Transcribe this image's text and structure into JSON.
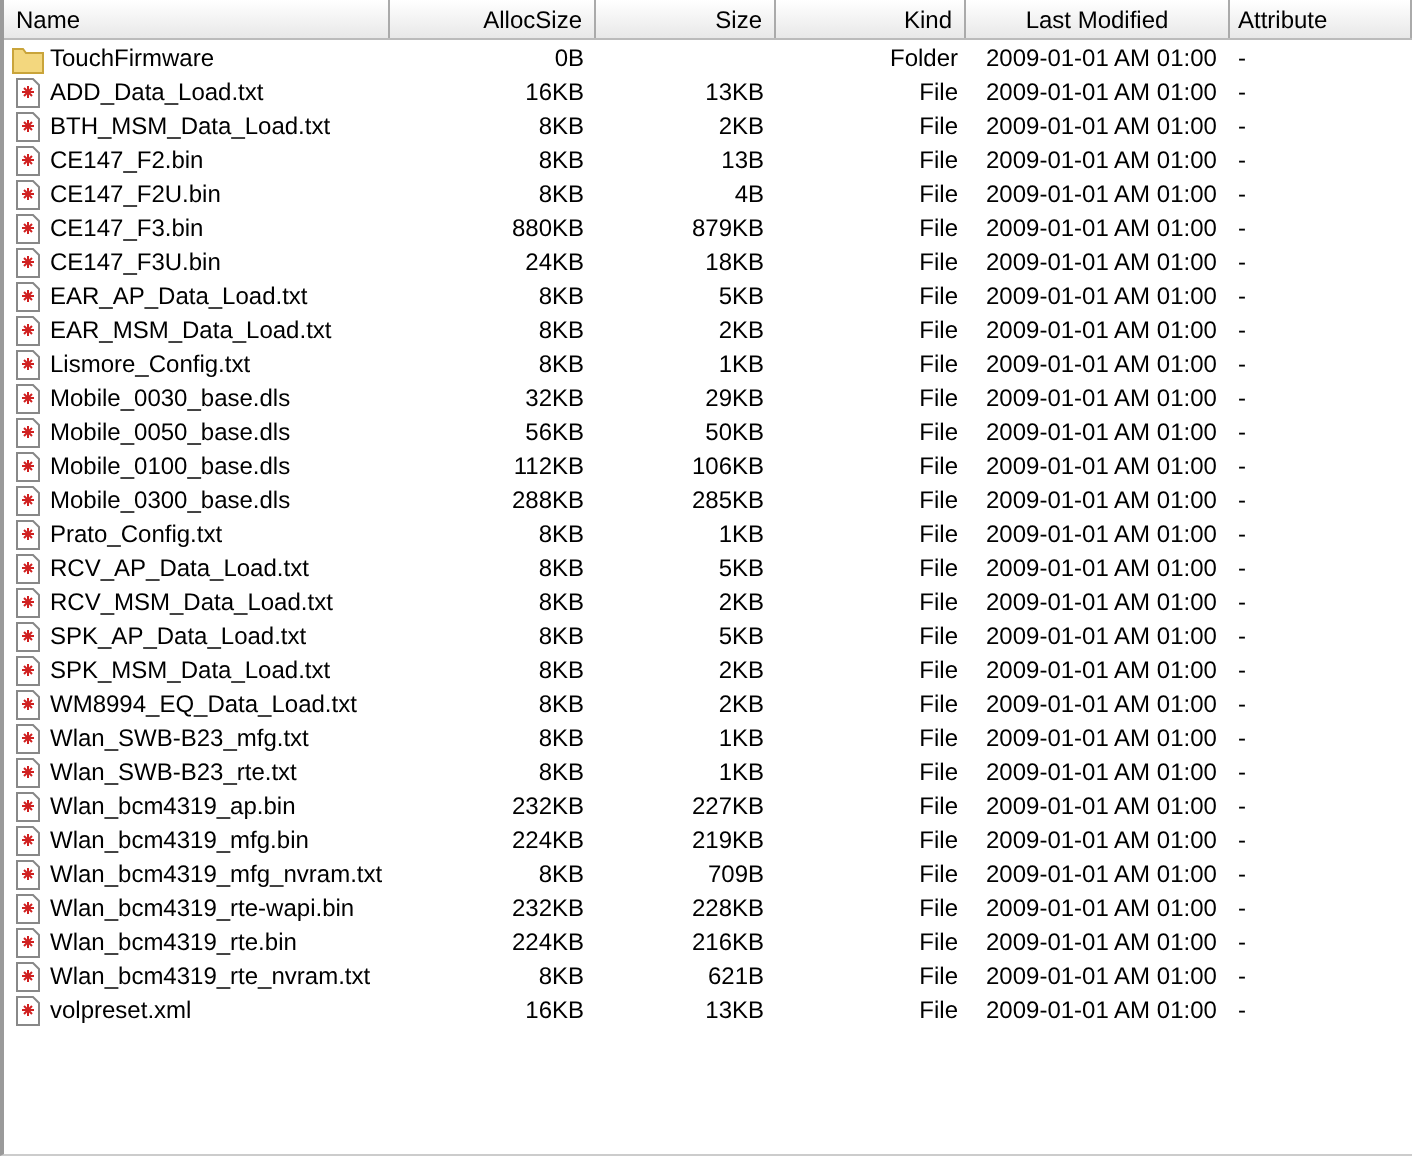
{
  "columns": [
    "Name",
    "AllocSize",
    "Size",
    "Kind",
    "Last Modified",
    "Attribute"
  ],
  "rows": [
    {
      "kind": "folder",
      "name": "TouchFirmware",
      "alloc": "0B",
      "size": "",
      "type": "Folder",
      "modified": "2009-01-01 AM 01:00",
      "attribute": "-"
    },
    {
      "kind": "file",
      "name": "ADD_Data_Load.txt",
      "alloc": "16KB",
      "size": "13KB",
      "type": "File",
      "modified": "2009-01-01 AM 01:00",
      "attribute": "-"
    },
    {
      "kind": "file",
      "name": "BTH_MSM_Data_Load.txt",
      "alloc": "8KB",
      "size": "2KB",
      "type": "File",
      "modified": "2009-01-01 AM 01:00",
      "attribute": "-"
    },
    {
      "kind": "file",
      "name": "CE147_F2.bin",
      "alloc": "8KB",
      "size": "13B",
      "type": "File",
      "modified": "2009-01-01 AM 01:00",
      "attribute": "-"
    },
    {
      "kind": "file",
      "name": "CE147_F2U.bin",
      "alloc": "8KB",
      "size": "4B",
      "type": "File",
      "modified": "2009-01-01 AM 01:00",
      "attribute": "-"
    },
    {
      "kind": "file",
      "name": "CE147_F3.bin",
      "alloc": "880KB",
      "size": "879KB",
      "type": "File",
      "modified": "2009-01-01 AM 01:00",
      "attribute": "-"
    },
    {
      "kind": "file",
      "name": "CE147_F3U.bin",
      "alloc": "24KB",
      "size": "18KB",
      "type": "File",
      "modified": "2009-01-01 AM 01:00",
      "attribute": "-"
    },
    {
      "kind": "file",
      "name": "EAR_AP_Data_Load.txt",
      "alloc": "8KB",
      "size": "5KB",
      "type": "File",
      "modified": "2009-01-01 AM 01:00",
      "attribute": "-"
    },
    {
      "kind": "file",
      "name": "EAR_MSM_Data_Load.txt",
      "alloc": "8KB",
      "size": "2KB",
      "type": "File",
      "modified": "2009-01-01 AM 01:00",
      "attribute": "-"
    },
    {
      "kind": "file",
      "name": "Lismore_Config.txt",
      "alloc": "8KB",
      "size": "1KB",
      "type": "File",
      "modified": "2009-01-01 AM 01:00",
      "attribute": "-"
    },
    {
      "kind": "file",
      "name": "Mobile_0030_base.dls",
      "alloc": "32KB",
      "size": "29KB",
      "type": "File",
      "modified": "2009-01-01 AM 01:00",
      "attribute": "-"
    },
    {
      "kind": "file",
      "name": "Mobile_0050_base.dls",
      "alloc": "56KB",
      "size": "50KB",
      "type": "File",
      "modified": "2009-01-01 AM 01:00",
      "attribute": "-"
    },
    {
      "kind": "file",
      "name": "Mobile_0100_base.dls",
      "alloc": "112KB",
      "size": "106KB",
      "type": "File",
      "modified": "2009-01-01 AM 01:00",
      "attribute": "-"
    },
    {
      "kind": "file",
      "name": "Mobile_0300_base.dls",
      "alloc": "288KB",
      "size": "285KB",
      "type": "File",
      "modified": "2009-01-01 AM 01:00",
      "attribute": "-"
    },
    {
      "kind": "file",
      "name": "Prato_Config.txt",
      "alloc": "8KB",
      "size": "1KB",
      "type": "File",
      "modified": "2009-01-01 AM 01:00",
      "attribute": "-"
    },
    {
      "kind": "file",
      "name": "RCV_AP_Data_Load.txt",
      "alloc": "8KB",
      "size": "5KB",
      "type": "File",
      "modified": "2009-01-01 AM 01:00",
      "attribute": "-"
    },
    {
      "kind": "file",
      "name": "RCV_MSM_Data_Load.txt",
      "alloc": "8KB",
      "size": "2KB",
      "type": "File",
      "modified": "2009-01-01 AM 01:00",
      "attribute": "-"
    },
    {
      "kind": "file",
      "name": "SPK_AP_Data_Load.txt",
      "alloc": "8KB",
      "size": "5KB",
      "type": "File",
      "modified": "2009-01-01 AM 01:00",
      "attribute": "-"
    },
    {
      "kind": "file",
      "name": "SPK_MSM_Data_Load.txt",
      "alloc": "8KB",
      "size": "2KB",
      "type": "File",
      "modified": "2009-01-01 AM 01:00",
      "attribute": "-"
    },
    {
      "kind": "file",
      "name": "WM8994_EQ_Data_Load.txt",
      "alloc": "8KB",
      "size": "2KB",
      "type": "File",
      "modified": "2009-01-01 AM 01:00",
      "attribute": "-"
    },
    {
      "kind": "file",
      "name": "Wlan_SWB-B23_mfg.txt",
      "alloc": "8KB",
      "size": "1KB",
      "type": "File",
      "modified": "2009-01-01 AM 01:00",
      "attribute": "-"
    },
    {
      "kind": "file",
      "name": "Wlan_SWB-B23_rte.txt",
      "alloc": "8KB",
      "size": "1KB",
      "type": "File",
      "modified": "2009-01-01 AM 01:00",
      "attribute": "-"
    },
    {
      "kind": "file",
      "name": "Wlan_bcm4319_ap.bin",
      "alloc": "232KB",
      "size": "227KB",
      "type": "File",
      "modified": "2009-01-01 AM 01:00",
      "attribute": "-"
    },
    {
      "kind": "file",
      "name": "Wlan_bcm4319_mfg.bin",
      "alloc": "224KB",
      "size": "219KB",
      "type": "File",
      "modified": "2009-01-01 AM 01:00",
      "attribute": "-"
    },
    {
      "kind": "file",
      "name": "Wlan_bcm4319_mfg_nvram.txt",
      "alloc": "8KB",
      "size": "709B",
      "type": "File",
      "modified": "2009-01-01 AM 01:00",
      "attribute": "-"
    },
    {
      "kind": "file",
      "name": "Wlan_bcm4319_rte-wapi.bin",
      "alloc": "232KB",
      "size": "228KB",
      "type": "File",
      "modified": "2009-01-01 AM 01:00",
      "attribute": "-"
    },
    {
      "kind": "file",
      "name": "Wlan_bcm4319_rte.bin",
      "alloc": "224KB",
      "size": "216KB",
      "type": "File",
      "modified": "2009-01-01 AM 01:00",
      "attribute": "-"
    },
    {
      "kind": "file",
      "name": "Wlan_bcm4319_rte_nvram.txt",
      "alloc": "8KB",
      "size": "621B",
      "type": "File",
      "modified": "2009-01-01 AM 01:00",
      "attribute": "-"
    },
    {
      "kind": "file",
      "name": "volpreset.xml",
      "alloc": "16KB",
      "size": "13KB",
      "type": "File",
      "modified": "2009-01-01 AM 01:00",
      "attribute": "-"
    }
  ]
}
